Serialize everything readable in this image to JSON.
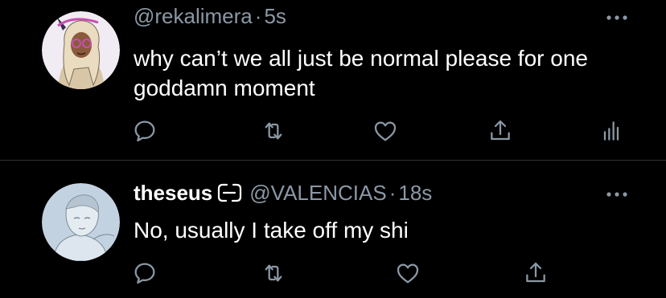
{
  "colors": {
    "background": "#000000",
    "text_primary": "#ffffff",
    "text_secondary": "#8b98a5",
    "divider": "#2f3336",
    "icon": "#8b98a5"
  },
  "tweets": [
    {
      "display_name": "",
      "handle": "@rekalimera",
      "separator": "·",
      "time": "5s",
      "text": "why can’t we all just be normal please for one goddamn moment",
      "avatar_icon": "avatar-illustration-icon",
      "more_icon": "ellipsis-icon",
      "actions": [
        "reply-icon",
        "retweet-icon",
        "like-icon",
        "share-icon",
        "analytics-icon"
      ]
    },
    {
      "display_name": "theseus",
      "name_emoji": "link-emoji-icon",
      "handle": "@VALENCIAS",
      "separator": "·",
      "time": "18s",
      "text": "No, usually I take off my shi",
      "avatar_icon": "avatar-sketch-icon",
      "more_icon": "ellipsis-icon",
      "actions": [
        "reply-icon",
        "retweet-icon",
        "like-icon",
        "share-icon"
      ]
    }
  ]
}
